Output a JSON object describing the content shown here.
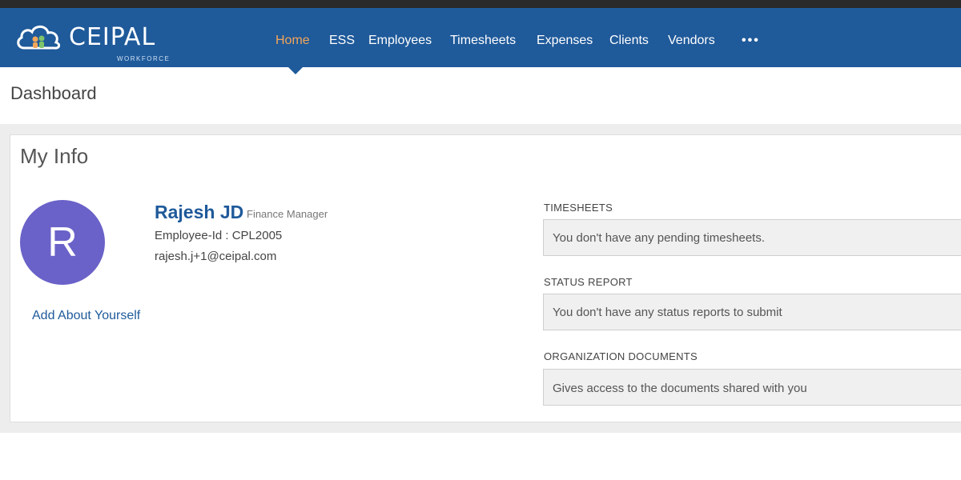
{
  "app": {
    "logo_text": "CEIPAL",
    "logo_sub": "WORKFORCE"
  },
  "nav": {
    "items": [
      {
        "label": "Home",
        "active": true
      },
      {
        "label": "ESS"
      },
      {
        "label": "Employees"
      },
      {
        "label": "Timesheets"
      },
      {
        "label": "Expenses"
      },
      {
        "label": "Clients"
      },
      {
        "label": "Vendors"
      }
    ],
    "more_label": "•••"
  },
  "page": {
    "title": "Dashboard"
  },
  "my_info": {
    "title": "My Info",
    "avatar_initial": "R",
    "name": "Rajesh JD",
    "role": "Finance Manager",
    "employee_id": "Employee-Id : CPL2005",
    "email": "rajesh.j+1@ceipal.com",
    "about_link": "Add About Yourself"
  },
  "sections": [
    {
      "label": "TIMESHEETS",
      "text": "You don't have any pending timesheets."
    },
    {
      "label": "STATUS REPORT",
      "text": "You don't have any status reports to submit"
    },
    {
      "label": "ORGANIZATION DOCUMENTS",
      "text": "Gives access to the documents shared with you"
    }
  ],
  "colors": {
    "navbar": "#1f5a9a",
    "active_nav": "#f2a65a",
    "avatar": "#6a62c8"
  }
}
